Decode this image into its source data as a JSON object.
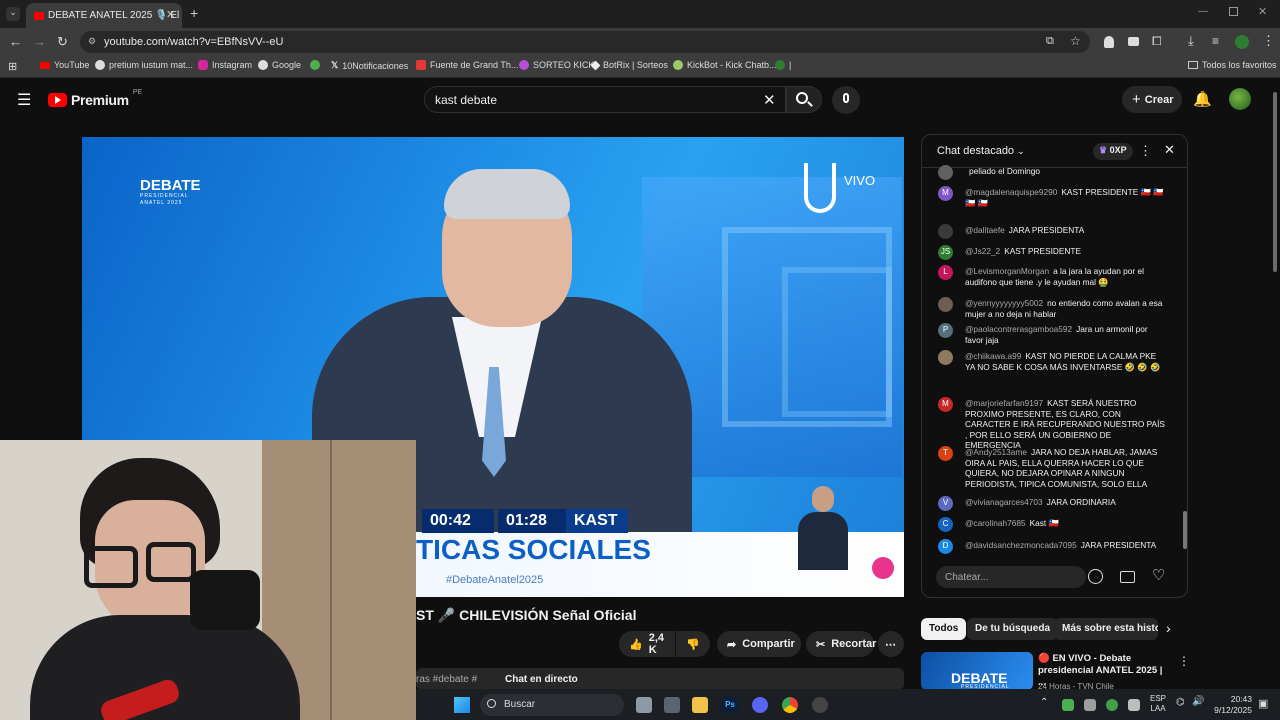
{
  "browser": {
    "tab_title": "DEBATE ANATEL 2025 🎙️ El",
    "url": "youtube.com/watch?v=EBfNsVV--eU",
    "bookmarks": [
      "YouTube",
      "pretium iustum mat...",
      "Instagram",
      "Google",
      "10Notificaciones",
      "Fuente de Grand Th...",
      "SORTEO KICK",
      "BotRix | Sorteos",
      "KickBot - Kick Chatb...",
      "|",
      "Todos los favoritos"
    ]
  },
  "youtube": {
    "logo_text": "Premium",
    "logo_sup": "PE",
    "search_value": "kast debate",
    "create_label": "Crear"
  },
  "video": {
    "debate_logo": "DEBATE",
    "debate_logo_sub": "PRESIDENCIAL",
    "debate_logo_sub2": "ANATEL 2025",
    "vivo": "VIVO",
    "timer1": "00:42",
    "timer2": "01:28",
    "candidate": "KAST",
    "banner_title": "TICAS SOCIALES",
    "hashtag": "#DebateAnatel2025"
  },
  "below_video": {
    "title_fragment": "ST 🎤 CHILEVISIÓN Señal Oficial",
    "likes": "2,4 K",
    "share_label": "Compartir",
    "clip_label": "Recortar",
    "hashtag_strip": "ras  #debate #",
    "live_chat": "Chat en directo"
  },
  "chat": {
    "title": "Chat destacado",
    "xp": "0XP",
    "input_placeholder": "Chatear...",
    "messages": [
      {
        "author": "",
        "text": "peliado el Domingo",
        "avatar": "",
        "color": "#606060"
      },
      {
        "author": "@magdalenaquispe9290",
        "text": "KAST PRESIDENTE 🇨🇱 🇨🇱 🇨🇱 🇨🇱",
        "avatar": "M",
        "color": "#7e57c2"
      },
      {
        "author": "@dalitaefe",
        "text": "JARA PRESIDENTA",
        "avatar": "",
        "color": "#3a3a3a"
      },
      {
        "author": "@Js22_2",
        "text": "KAST PRESIDENTE",
        "avatar": "JS",
        "color": "#2e7d32"
      },
      {
        "author": "@LevismorganMorgan",
        "text": "a la jara la ayudan por el audifono que tiene .y le ayudan mal 🤮",
        "avatar": "L",
        "color": "#c2185b"
      },
      {
        "author": "@yennyyyyyyyy5002",
        "text": "no entiendo como avalan a esa mujer a no deja ni hablar",
        "avatar": "",
        "color": "#6d5d52"
      },
      {
        "author": "@paolacontrerasgamboa592",
        "text": "Jara un armonil por favor jaja",
        "avatar": "P",
        "color": "#546e7a"
      },
      {
        "author": "@chiikawa.a99",
        "text": "KAST NO PIERDE LA CALMA PKE YA NO SABE K COSA MÁS INVENTARSE 🤣 🤣 🤣",
        "avatar": "",
        "color": "#8d7a5e"
      },
      {
        "author": "@marjoriefarfan9197",
        "text": "KAST SERÁ NUESTRO PROXIMO PRESENTE, ES CLARO, CON CARACTER E IRÁ RECUPERANDO NUESTRO PAÍS , POR ELLO SERÁ UN GOBIERNO DE EMERGENCIA",
        "avatar": "M",
        "color": "#c62828"
      },
      {
        "author": "@Andy2513ame",
        "text": "JARA NO DEJA HABLAR, JAMAS OIRA AL PAIS, ELLA QUERRA HACER LO QUE QUIERA, NO DEJARA OPINAR A NINGUN PERIODISTA, TIPICA COMUNISTA, SOLO ELLA",
        "avatar": "T",
        "color": "#d84315"
      },
      {
        "author": "@vivianagarces4703",
        "text": "JARA ORDINARIA",
        "avatar": "V",
        "color": "#5c6bc0"
      },
      {
        "author": "@carolinah7685",
        "text": "Kast 🇨🇱",
        "avatar": "C",
        "color": "#1565c0"
      },
      {
        "author": "@davidsanchezmoncada7095",
        "text": "JARA PRESIDENTA",
        "avatar": "D",
        "color": "#1e88e5"
      }
    ]
  },
  "related": {
    "chips": [
      "Todos",
      "De tu búsqueda",
      "Más sobre esta histor"
    ],
    "first_item_thumb": "DEBATE",
    "first_item_thumb_sub": "PRESIDENCIAL",
    "first_item_title": "🔴 EN VIVO - Debate presidencial ANATEL 2025 | ...",
    "first_item_channel": "24 Horas - TVN Chile"
  },
  "taskbar": {
    "search_label": "Buscar",
    "lang1": "ESP",
    "lang2": "LAA",
    "time": "20:43",
    "date": "9/12/2025"
  }
}
